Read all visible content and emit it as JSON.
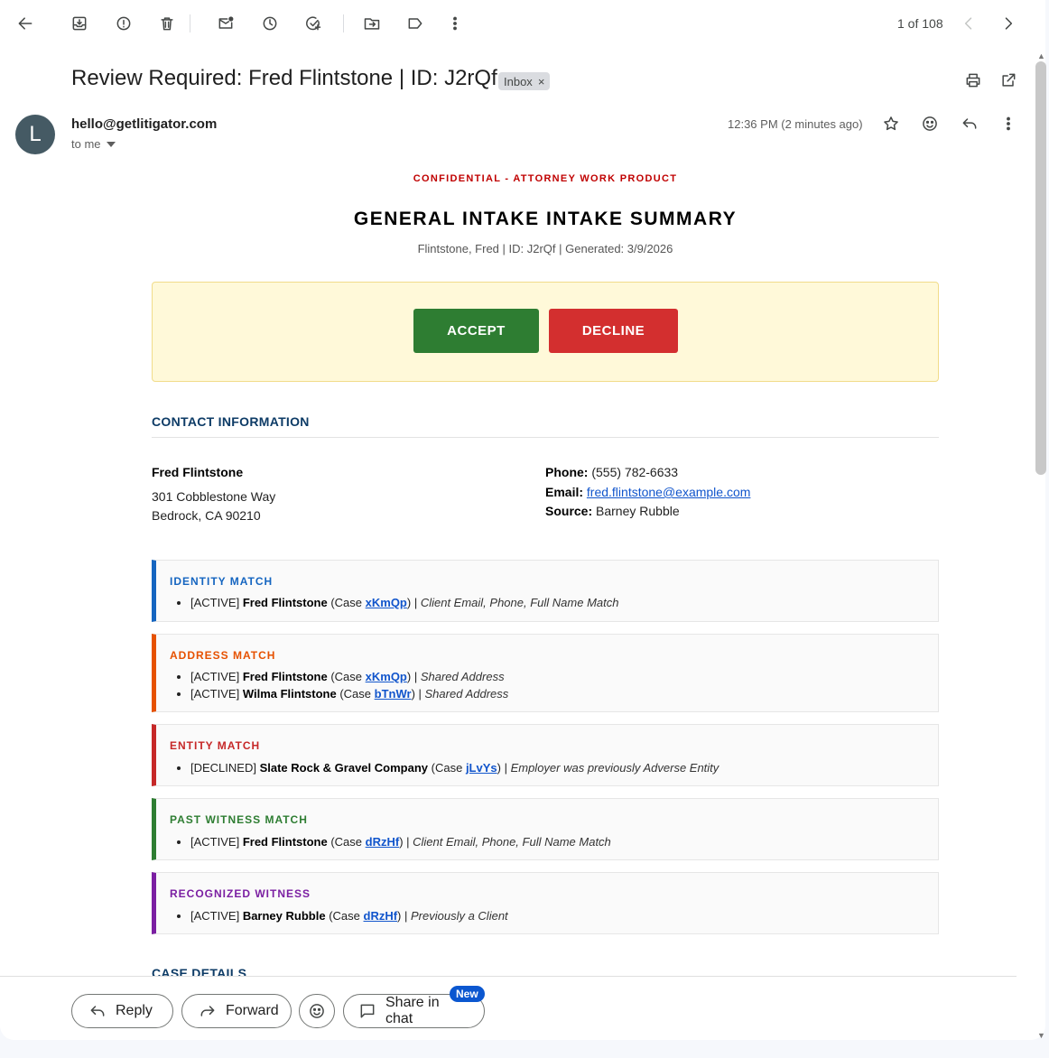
{
  "toolbar": {
    "pager": "1 of 108"
  },
  "email": {
    "subject": "Review Required: Fred Flintstone | ID: J2rQf",
    "label_chip": "Inbox",
    "label_remove": "×",
    "avatar_letter": "L",
    "sender": "hello@getlitigator.com",
    "to": "to me",
    "time": "12:36 PM (2 minutes ago)"
  },
  "doc": {
    "confidential": "CONFIDENTIAL - ATTORNEY WORK PRODUCT",
    "title": "GENERAL INTAKE INTAKE SUMMARY",
    "subtitle": "Flintstone, Fred | ID: J2rQf | Generated: 3/9/2026",
    "accept": "ACCEPT",
    "decline": "DECLINE",
    "contact_heading": "CONTACT INFORMATION",
    "contact": {
      "name": "Fred Flintstone",
      "address1": "301 Cobblestone Way",
      "address2": "Bedrock, CA 90210",
      "phone_label": "Phone:",
      "phone": "(555) 782-6633",
      "email_label": "Email:",
      "email": "fred.flintstone@example.com",
      "source_label": "Source:",
      "source": "Barney Rubble"
    },
    "matches": [
      {
        "title": "IDENTITY MATCH",
        "color": "#1565c0",
        "items": [
          {
            "status": "[ACTIVE]",
            "name": "Fred Flintstone",
            "case_prefix": "(Case",
            "case": "xKmQp",
            "case_suffix": ") |",
            "note": "Client Email, Phone, Full Name Match"
          }
        ]
      },
      {
        "title": "ADDRESS MATCH",
        "color": "#e65100",
        "items": [
          {
            "status": "[ACTIVE]",
            "name": "Fred Flintstone",
            "case_prefix": "(Case",
            "case": "xKmQp",
            "case_suffix": ") |",
            "note": "Shared Address"
          },
          {
            "status": "[ACTIVE]",
            "name": "Wilma Flintstone",
            "case_prefix": "(Case",
            "case": "bTnWr",
            "case_suffix": ") |",
            "note": "Shared Address"
          }
        ]
      },
      {
        "title": "ENTITY MATCH",
        "color": "#c62828",
        "items": [
          {
            "status": "[DECLINED]",
            "name": "Slate Rock & Gravel Company",
            "case_prefix": "(Case",
            "case": "jLvYs",
            "case_suffix": ") |",
            "note": "Employer was previously Adverse Entity"
          }
        ]
      },
      {
        "title": "PAST WITNESS MATCH",
        "color": "#2e7d32",
        "items": [
          {
            "status": "[ACTIVE]",
            "name": "Fred Flintstone",
            "case_prefix": "(Case",
            "case": "dRzHf",
            "case_suffix": ") |",
            "note": "Client Email, Phone, Full Name Match"
          }
        ]
      },
      {
        "title": "RECOGNIZED WITNESS",
        "color": "#7b1fa2",
        "items": [
          {
            "status": "[ACTIVE]",
            "name": "Barney Rubble",
            "case_prefix": "(Case",
            "case": "dRzHf",
            "case_suffix": ") |",
            "note": "Previously a Client"
          }
        ]
      }
    ],
    "case_heading": "CASE DETAILS"
  },
  "bottom": {
    "reply": "Reply",
    "forward": "Forward",
    "share": "Share in chat",
    "new_badge": "New"
  },
  "icons": [
    "back-arrow-icon",
    "archive-icon",
    "report-spam-icon",
    "delete-icon",
    "mark-unread-icon",
    "snooze-icon",
    "add-task-icon",
    "move-to-icon",
    "label-icon",
    "more-vert-icon",
    "chevron-left-icon",
    "chevron-right-icon",
    "print-icon",
    "open-in-new-icon",
    "star-icon",
    "emoji-icon",
    "reply-icon",
    "chevron-down-icon",
    "forward-icon",
    "chat-icon"
  ]
}
